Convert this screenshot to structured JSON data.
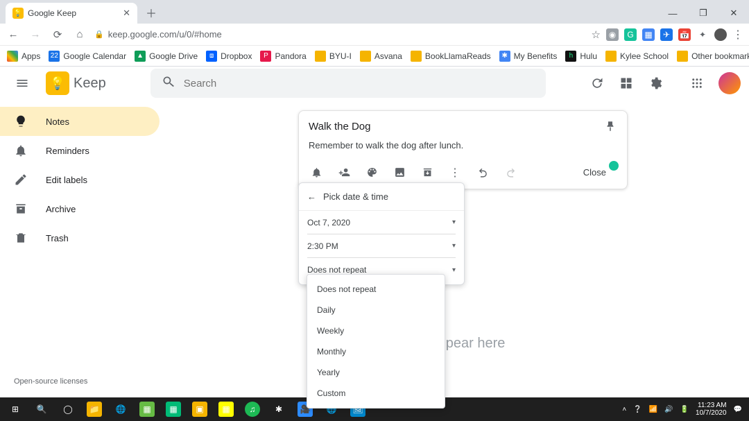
{
  "browser": {
    "tab_title": "Google Keep",
    "url": "keep.google.com/u/0/#home",
    "window": {
      "min": "—",
      "max": "❐",
      "close": "✕"
    }
  },
  "bookmarks": {
    "apps": "Apps",
    "items": [
      {
        "label": "Google Calendar",
        "color": "#1a73e8"
      },
      {
        "label": "Google Drive",
        "color": "#0f9d58"
      },
      {
        "label": "Dropbox",
        "color": "#0061ff"
      },
      {
        "label": "Pandora",
        "color": "#e6194b"
      },
      {
        "label": "BYU-I",
        "color": "#f5b400"
      },
      {
        "label": "Asvana",
        "color": "#f5b400"
      },
      {
        "label": "BookLlamaReads",
        "color": "#f5b400"
      },
      {
        "label": "My Benefits",
        "color": "#4285f4"
      },
      {
        "label": "Hulu",
        "color": "#1ce783"
      },
      {
        "label": "Kylee School",
        "color": "#f5b400"
      }
    ],
    "other": "Other bookmarks"
  },
  "keep": {
    "brand": "Keep",
    "search_placeholder": "Search"
  },
  "sidebar": {
    "items": [
      {
        "label": "Notes"
      },
      {
        "label": "Reminders"
      },
      {
        "label": "Edit labels"
      },
      {
        "label": "Archive"
      },
      {
        "label": "Trash"
      }
    ],
    "licenses": "Open-source licenses"
  },
  "note": {
    "title": "Walk the Dog",
    "body": "Remember to walk the dog after lunch.",
    "close": "Close"
  },
  "dt_popup": {
    "header": "Pick date & time",
    "date": "Oct 7, 2020",
    "time": "2:30 PM",
    "repeat": "Does not repeat"
  },
  "repeat_options": [
    "Does not repeat",
    "Daily",
    "Weekly",
    "Monthly",
    "Yearly",
    "Custom"
  ],
  "background": {
    "hint": "add appear here"
  },
  "addrbar_icons": {
    "star": "☆",
    "camera": "#9aa0a6",
    "grammarly": "#15c39a",
    "ext1": "#4285f4",
    "ext2": "#1a73e8",
    "ext3": "#ea4335",
    "puzzle": "#5f6368"
  },
  "clock": {
    "time": "11:23 AM",
    "date": "10/7/2020"
  }
}
